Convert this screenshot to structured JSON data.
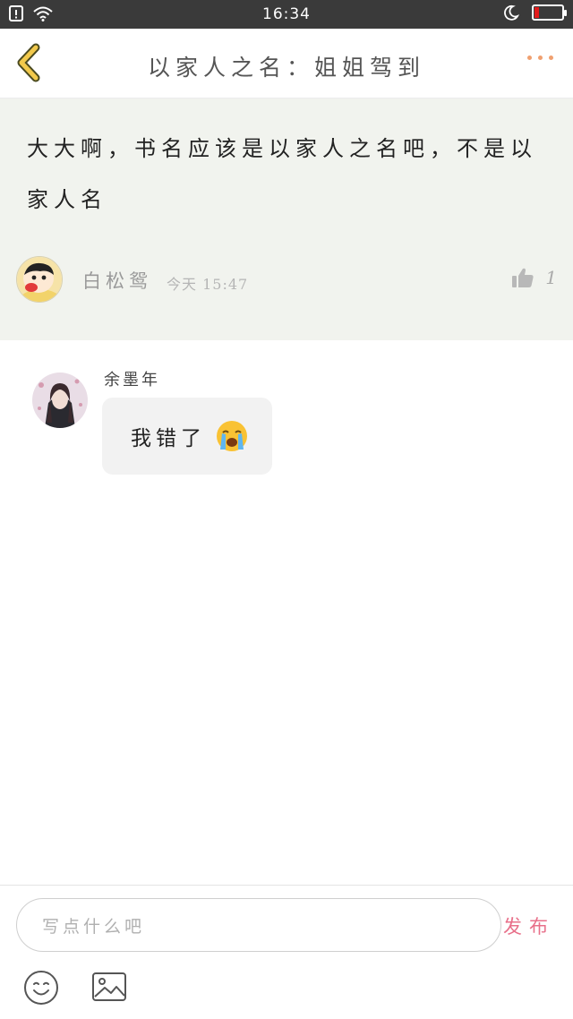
{
  "status_bar": {
    "time": "16:34",
    "icons": [
      "notification-icon",
      "wifi-icon",
      "night-mode-icon",
      "battery-icon"
    ],
    "battery_level": 0.15,
    "battery_color": "#e21b1b"
  },
  "header": {
    "title": "以家人之名：姐姐驾到",
    "back_icon": "chevron-left-icon",
    "more_icon": "more-dots-icon",
    "back_color": "#f2c94c",
    "more_color": "#f0a070"
  },
  "comment": {
    "text": "大大啊，书名应该是以家人之名吧，不是以家人名",
    "author": "白松鸳",
    "time": "今天 15:47",
    "likes": "1",
    "like_icon": "thumbs-up-icon",
    "background": "#f1f3ee"
  },
  "reply": {
    "author": "余墨年",
    "text": "我错了",
    "emoji": "😭",
    "bubble_color": "#f2f2f2"
  },
  "composer": {
    "placeholder": "写点什么吧",
    "submit_label": "发布",
    "submit_color": "#e8708a",
    "tools": [
      "emoji-icon",
      "image-icon"
    ]
  }
}
